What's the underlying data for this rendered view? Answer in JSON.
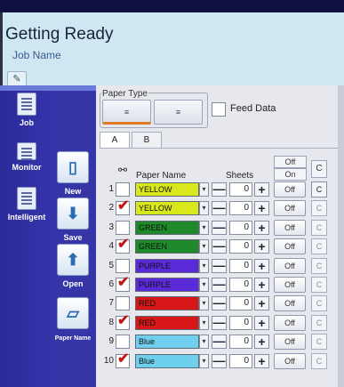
{
  "header": {
    "title": "Getting Ready",
    "job_name_label": "Job Name",
    "edit_icon": "pencil-icon"
  },
  "nav": [
    {
      "label": "Job",
      "icon": "job-icon"
    },
    {
      "label": "Monitor",
      "icon": "monitor-icon"
    },
    {
      "label": "Intelligent",
      "icon": "intelligent-icon"
    }
  ],
  "actions": [
    {
      "label": "New",
      "icon": "new-icon"
    },
    {
      "label": "Save",
      "icon": "save-icon"
    },
    {
      "label": "Open",
      "icon": "open-icon"
    },
    {
      "label": "Paper Name",
      "icon": "paper-name-icon"
    }
  ],
  "paper_type": {
    "label": "Paper Type",
    "buttons": [
      "≡",
      "≡"
    ]
  },
  "feed_data": {
    "label": "Feed Data",
    "checked": false
  },
  "tabs": [
    "A",
    "B"
  ],
  "table": {
    "link_icon": "link-icon",
    "col_paper": "Paper Name",
    "col_sheets": "Sheets",
    "hdr_off": "Off",
    "hdr_on": "On",
    "hdr_c": "C",
    "minus": "—",
    "plus": "+",
    "dropdown": "▾",
    "rows": [
      {
        "num": "1",
        "checked": false,
        "name": "YELLOW",
        "color": "#d9e81a",
        "sheets": "0",
        "off": "Off",
        "c": "C",
        "c_enabled": true
      },
      {
        "num": "2",
        "checked": true,
        "name": "YELLOW",
        "color": "#d9e81a",
        "sheets": "0",
        "off": "Off",
        "c": "C",
        "c_enabled": false
      },
      {
        "num": "3",
        "checked": false,
        "name": "GREEN",
        "color": "#1e8a2a",
        "sheets": "0",
        "off": "Off",
        "c": "C",
        "c_enabled": false
      },
      {
        "num": "4",
        "checked": true,
        "name": "GREEN",
        "color": "#1e8a2a",
        "sheets": "0",
        "off": "Off",
        "c": "C",
        "c_enabled": false
      },
      {
        "num": "5",
        "checked": false,
        "name": "PURPLE",
        "color": "#5a2ad8",
        "sheets": "0",
        "off": "Off",
        "c": "C",
        "c_enabled": false
      },
      {
        "num": "6",
        "checked": true,
        "name": "PURPLE",
        "color": "#5a2ad8",
        "sheets": "0",
        "off": "Off",
        "c": "C",
        "c_enabled": false
      },
      {
        "num": "7",
        "checked": false,
        "name": "RED",
        "color": "#d81818",
        "sheets": "0",
        "off": "Off",
        "c": "C",
        "c_enabled": false
      },
      {
        "num": "8",
        "checked": true,
        "name": "RED",
        "color": "#d81818",
        "sheets": "0",
        "off": "Off",
        "c": "C",
        "c_enabled": false
      },
      {
        "num": "9",
        "checked": false,
        "name": "Blue",
        "color": "#6fd0ee",
        "sheets": "0",
        "off": "Off",
        "c": "C",
        "c_enabled": false
      },
      {
        "num": "10",
        "checked": true,
        "name": "Blue",
        "color": "#6fd0ee",
        "sheets": "0",
        "off": "Off",
        "c": "C",
        "c_enabled": false
      }
    ]
  }
}
